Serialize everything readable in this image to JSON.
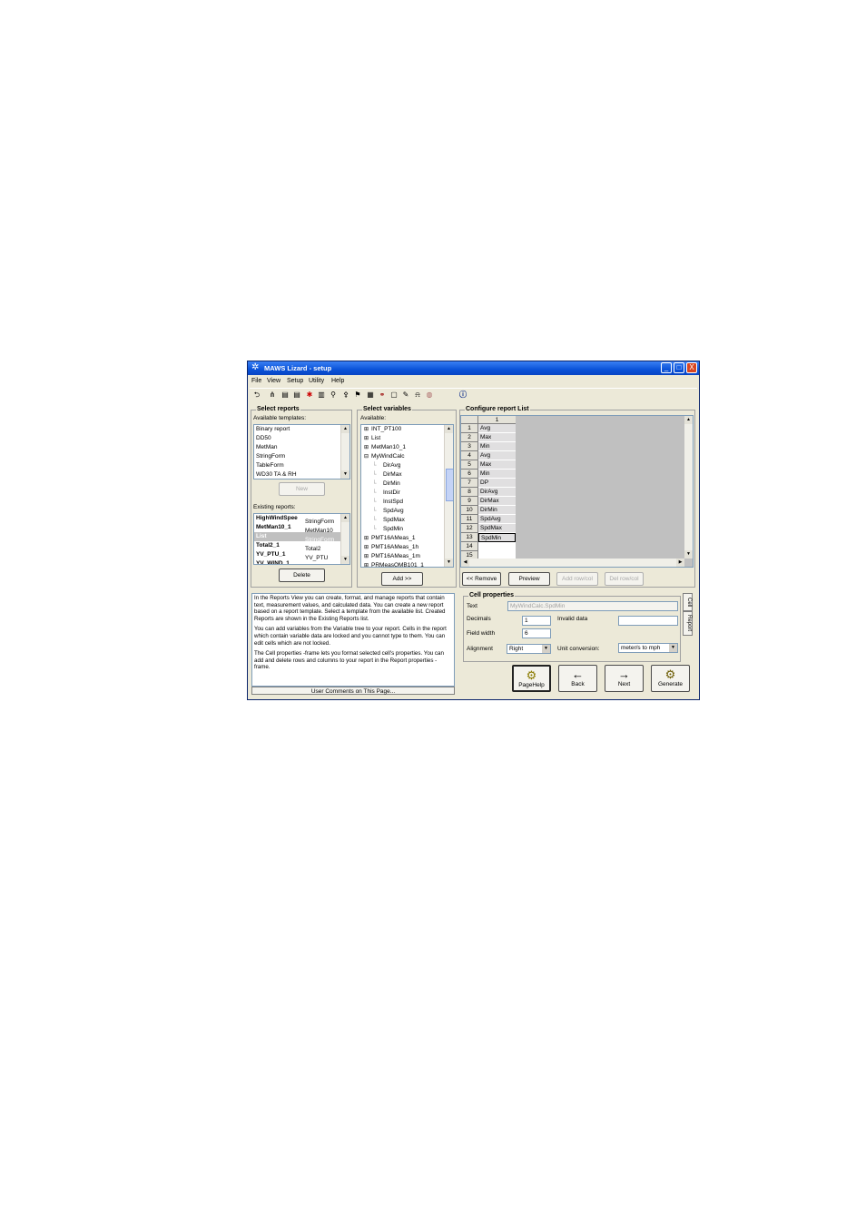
{
  "window": {
    "title": "MAWS Lizard - setup"
  },
  "titlebar_buttons": {
    "minimize": "_",
    "maximize": "□",
    "close": "X"
  },
  "menu": [
    "File",
    "View",
    "Setup",
    "Utility",
    "Help"
  ],
  "toolbar": {
    "icons": [
      "back-arrow",
      "network",
      "dev1",
      "dev2",
      "asterisk",
      "grid",
      "tripod",
      "antenna",
      "flag",
      "table",
      "cable",
      "doc",
      "pen",
      "bell",
      "globe",
      "info"
    ]
  },
  "select_reports": {
    "title": "Select reports",
    "available_label": "Available templates:",
    "templates": [
      "Binary report",
      "DD50",
      "MetMan",
      "StringForm",
      "TableForm",
      "WD30 TA & RH"
    ],
    "new_button": "New",
    "existing_label": "Existing reports:",
    "existing": [
      {
        "name": "HighWindSpee",
        "type": "StringForm",
        "bold": true,
        "selected": false
      },
      {
        "name": "MetMan10_1",
        "type": "MetMan10",
        "bold": true,
        "selected": false
      },
      {
        "name": "List",
        "type": "StringForm",
        "bold": true,
        "selected": true
      },
      {
        "name": "Total2_1",
        "type": "Total2",
        "bold": true,
        "selected": false
      },
      {
        "name": "YV_PTU_1",
        "type": "YV_PTU",
        "bold": true,
        "selected": false
      },
      {
        "name": "YV_WIND_1",
        "type": "YV_WIND",
        "bold": true,
        "selected": false
      }
    ],
    "delete_button": "Delete"
  },
  "select_variables": {
    "title": "Select variables",
    "available_label": "Available:",
    "tree": [
      {
        "label": "INT_PT100",
        "level": 0,
        "expander": "+"
      },
      {
        "label": "List",
        "level": 0,
        "expander": "+"
      },
      {
        "label": "MetMan10_1",
        "level": 0,
        "expander": "+"
      },
      {
        "label": "MyWindCalc",
        "level": 0,
        "expander": "-"
      },
      {
        "label": "DirAvg",
        "level": 1,
        "expander": ""
      },
      {
        "label": "DirMax",
        "level": 1,
        "expander": ""
      },
      {
        "label": "DirMin",
        "level": 1,
        "expander": ""
      },
      {
        "label": "InstDir",
        "level": 1,
        "expander": ""
      },
      {
        "label": "InstSpd",
        "level": 1,
        "expander": ""
      },
      {
        "label": "SpdAvg",
        "level": 1,
        "expander": ""
      },
      {
        "label": "SpdMax",
        "level": 1,
        "expander": ""
      },
      {
        "label": "SpdMin",
        "level": 1,
        "expander": ""
      },
      {
        "label": "PMT16AMeas_1",
        "level": 0,
        "expander": "+"
      },
      {
        "label": "PMT16AMeas_1h",
        "level": 0,
        "expander": "+"
      },
      {
        "label": "PMT16AMeas_1m",
        "level": 0,
        "expander": "+"
      },
      {
        "label": "PRMeasQMB101_1",
        "level": 0,
        "expander": "+"
      }
    ],
    "add_button": "Add >>"
  },
  "configure": {
    "title": "Configure report List",
    "column_header": "1",
    "rows": [
      {
        "n": "1",
        "v": "Avg"
      },
      {
        "n": "2",
        "v": "Max"
      },
      {
        "n": "3",
        "v": "Min"
      },
      {
        "n": "4",
        "v": "Avg"
      },
      {
        "n": "5",
        "v": "Max"
      },
      {
        "n": "6",
        "v": "Min"
      },
      {
        "n": "7",
        "v": "DP"
      },
      {
        "n": "8",
        "v": "DirAvg"
      },
      {
        "n": "9",
        "v": "DirMax"
      },
      {
        "n": "10",
        "v": "DirMin"
      },
      {
        "n": "11",
        "v": "SpdAvg"
      },
      {
        "n": "12",
        "v": "SpdMax"
      },
      {
        "n": "13",
        "v": "SpdMin"
      },
      {
        "n": "14",
        "v": ""
      },
      {
        "n": "15",
        "v": ""
      }
    ],
    "remove_button": "<< Remove",
    "preview_button": "Preview",
    "add_rowcol_button": "Add row/col",
    "del_rowcol_button": "Del row/col"
  },
  "help": {
    "paragraphs": [
      "In the Reports View you can create, format, and manage reports that contain text, measurement values, and calculated data. You can create a new report based on a report template. Select a template from the available list. Created Reports are shown in the Existing Reports list.",
      "You can add variables from the Variable tree to your report. Cells in the report which contain variable data are locked and you cannot type to them. You can edit cells which are not locked.",
      "The Cell properties -frame lets you format selected cell's properties. You can add and delete rows and columns to your report in the Report properties -frame."
    ],
    "comments_button": "User Comments on This Page..."
  },
  "cell_properties": {
    "title": "Cell properties",
    "text_label": "Text",
    "text_value": "MyWindCalc.SpdMin",
    "decimals_label": "Decimals",
    "decimals_value": "1",
    "invalid_label": "Invalid data",
    "invalid_value": "",
    "field_width_label": "Field width",
    "field_width_value": "6",
    "alignment_label": "Alignment",
    "alignment_value": "Right",
    "unit_label": "Unit conversion:",
    "unit_value": "meter/s to mph",
    "tab_cell": "Cell",
    "tab_report": "Report"
  },
  "nav_buttons": {
    "pagehelp": "PageHelp",
    "back": "Back",
    "next": "Next",
    "generate": "Generate"
  }
}
